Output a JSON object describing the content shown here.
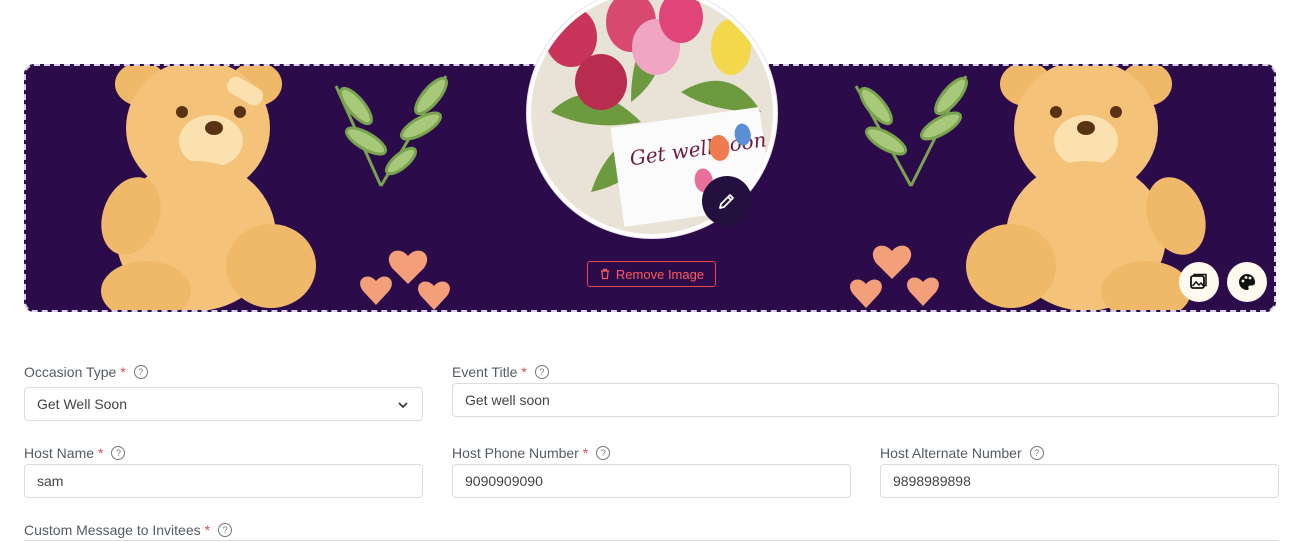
{
  "banner": {
    "card_text": "Get well soon",
    "remove_image_label": "Remove Image",
    "background_color": "#2b0b4a"
  },
  "icons": {
    "edit": "pencil-icon",
    "trash": "trash-icon",
    "gallery": "image-gallery-icon",
    "palette": "palette-icon",
    "help": "question-circle-icon",
    "chevron": "chevron-down-icon"
  },
  "form": {
    "occasion_type": {
      "label": "Occasion Type",
      "required": "*",
      "value": "Get Well Soon"
    },
    "event_title": {
      "label": "Event Title",
      "required": "*",
      "value": "Get well soon"
    },
    "host_name": {
      "label": "Host Name",
      "required": "*",
      "value": "sam"
    },
    "host_phone": {
      "label": "Host Phone Number",
      "required": "*",
      "value": "9090909090"
    },
    "host_alternate": {
      "label": "Host Alternate Number",
      "value": "9898989898"
    },
    "custom_message": {
      "label": "Custom Message to Invitees",
      "required": "*"
    }
  },
  "colors": {
    "accent_danger": "#e5484d",
    "banner_purple": "#2b0b4a",
    "edit_button": "#23103f"
  }
}
